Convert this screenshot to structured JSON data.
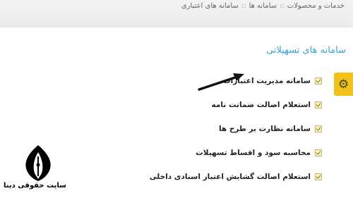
{
  "breadcrumb": {
    "items": [
      "خدمات و محصولات",
      "سامانه ها",
      "سامانه های اعتباری"
    ],
    "separator": "::"
  },
  "section": {
    "title": "سامانه های تسهیلاتی"
  },
  "menu": {
    "items": [
      {
        "label": "سامانه مدیریت اعتبارات"
      },
      {
        "label": "استعلام اصالت ضمانت نامه"
      },
      {
        "label": "سامانه نظارت بر طرح ها"
      },
      {
        "label": "محاسبه سود و اقساط تسهیلات"
      },
      {
        "label": "استعلام اصالت گشایش اعتبار اسنادی داخلی"
      }
    ]
  },
  "settings_tab": {
    "icon": "gear-icon"
  },
  "annotation": {
    "icon": "arrow-icon"
  },
  "watermark": {
    "text": "سایت حقوقی دینا",
    "icon": "pen-nib-logo"
  },
  "colors": {
    "title": "#3aa3cf",
    "gear_tab": "#f2c21a",
    "check_border": "#d6b04a",
    "check_mark": "#4a8a2a"
  }
}
